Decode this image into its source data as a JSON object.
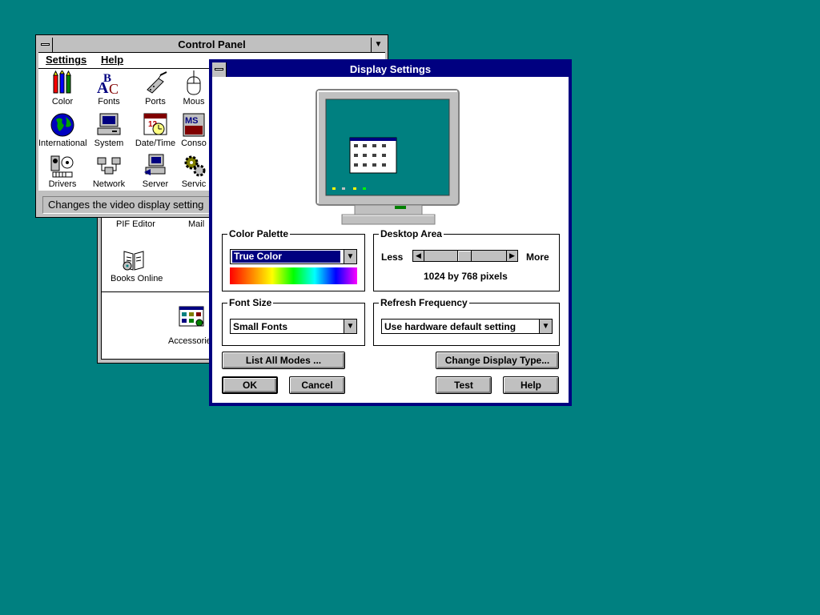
{
  "program_manager": {
    "icons": [
      {
        "label": "PIF Editor",
        "icon": "pif-editor-icon"
      },
      {
        "label": "Mail",
        "icon": "mail-icon"
      },
      {
        "label": "Books Online",
        "icon": "books-online-icon"
      },
      {
        "label": "Accessorie",
        "icon": "accessories-group-icon"
      }
    ]
  },
  "control_panel": {
    "title": "Control Panel",
    "menu": [
      "Settings",
      "Help"
    ],
    "icons": [
      {
        "label": "Color",
        "icon": "color-icon"
      },
      {
        "label": "Fonts",
        "icon": "fonts-icon"
      },
      {
        "label": "Ports",
        "icon": "ports-icon"
      },
      {
        "label": "Mous",
        "icon": "mouse-icon"
      },
      {
        "label": "International",
        "icon": "international-icon"
      },
      {
        "label": "System",
        "icon": "system-icon"
      },
      {
        "label": "Date/Time",
        "icon": "date-time-icon"
      },
      {
        "label": "Conso",
        "icon": "console-icon"
      },
      {
        "label": "Drivers",
        "icon": "drivers-icon"
      },
      {
        "label": "Network",
        "icon": "network-icon"
      },
      {
        "label": "Server",
        "icon": "server-icon"
      },
      {
        "label": "Servic",
        "icon": "services-icon"
      }
    ],
    "status": "Changes the video display setting"
  },
  "display_settings": {
    "title": "Display Settings",
    "color_palette": {
      "label": "Color Palette",
      "value": "True Color"
    },
    "desktop_area": {
      "label": "Desktop Area",
      "less": "Less",
      "more": "More",
      "resolution": "1024 by 768 pixels"
    },
    "font_size": {
      "label": "Font Size",
      "value": "Small Fonts"
    },
    "refresh_frequency": {
      "label": "Refresh Frequency",
      "value": "Use hardware default setting"
    },
    "buttons": {
      "list_all_modes": "List All Modes ...",
      "change_display_type": "Change Display Type...",
      "ok": "OK",
      "cancel": "Cancel",
      "test": "Test",
      "help": "Help"
    }
  },
  "colors": {
    "desktop": "#008080",
    "active_title": "#000080",
    "face": "#c0c0c0"
  }
}
